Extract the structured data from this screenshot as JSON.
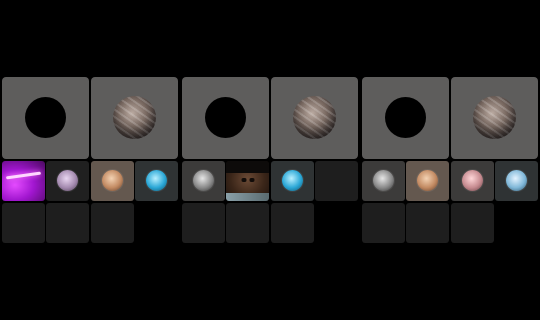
{
  "panels": [
    {
      "id": "p1",
      "large_tiles": [
        {
          "type": "camera-off",
          "icon": "black-circle"
        },
        {
          "type": "avatar",
          "avatar_name": "braided-hair-avatar"
        }
      ],
      "row1": [
        {
          "type": "video",
          "variant": "purple-neon"
        },
        {
          "type": "avatar",
          "variant": "lilac"
        },
        {
          "type": "avatar",
          "variant": "tan"
        },
        {
          "type": "avatar",
          "variant": "blue"
        }
      ],
      "row2": [
        {
          "type": "empty"
        },
        {
          "type": "empty"
        },
        {
          "type": "empty"
        },
        {
          "type": "none"
        }
      ]
    },
    {
      "id": "p2",
      "large_tiles": [
        {
          "type": "camera-off",
          "icon": "black-circle"
        },
        {
          "type": "avatar",
          "avatar_name": "braided-hair-avatar"
        }
      ],
      "row1": [
        {
          "type": "avatar",
          "variant": "gray"
        },
        {
          "type": "video",
          "variant": "face"
        },
        {
          "type": "avatar",
          "variant": "blue"
        },
        {
          "type": "empty"
        }
      ],
      "row2": [
        {
          "type": "empty"
        },
        {
          "type": "empty"
        },
        {
          "type": "empty"
        },
        {
          "type": "none"
        }
      ]
    },
    {
      "id": "p3",
      "large_tiles": [
        {
          "type": "camera-off",
          "icon": "black-circle"
        },
        {
          "type": "avatar",
          "avatar_name": "braided-hair-avatar"
        }
      ],
      "row1": [
        {
          "type": "avatar",
          "variant": "gray"
        },
        {
          "type": "avatar",
          "variant": "tan"
        },
        {
          "type": "avatar",
          "variant": "pink"
        },
        {
          "type": "avatar",
          "variant": "sky"
        }
      ],
      "row2": [
        {
          "type": "empty"
        },
        {
          "type": "empty"
        },
        {
          "type": "empty"
        },
        {
          "type": "none"
        }
      ]
    }
  ],
  "colors": {
    "background": "#000000",
    "large_tile": "#5e5d5c",
    "small_tile_empty": "#1e1e1e",
    "purple_video": "#a116cf"
  }
}
